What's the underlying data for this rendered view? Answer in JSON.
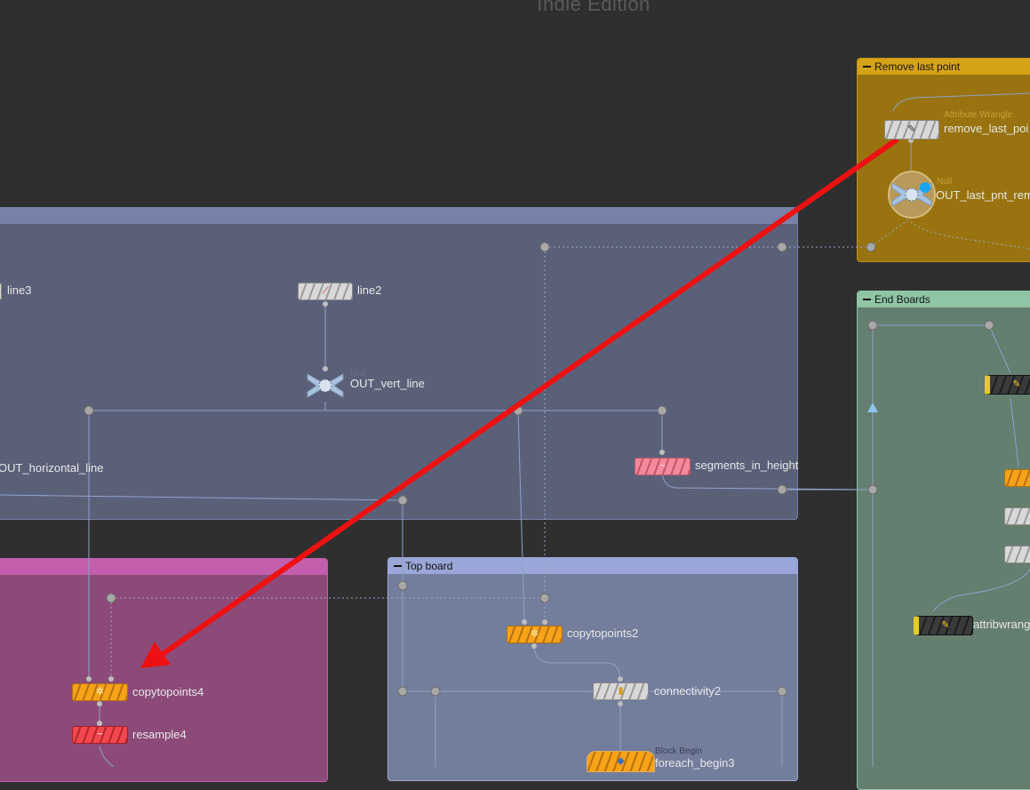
{
  "watermark": "Indie Edition",
  "boxes": {
    "remove_last_point": "Remove last point",
    "end_boards": "End Boards",
    "top_board": "Top board"
  },
  "nodes": {
    "line3": "line3",
    "line2": "line2",
    "out_vert_line": "OUT_vert_line",
    "out_vert_line_type": "Null",
    "out_horizontal_line": "OUT_horizontal_line",
    "segments_in_height": "segments_in_height",
    "copytopoints4": "copytopoints4",
    "resample4": "resample4",
    "copytopoints2": "copytopoints2",
    "connectivity2": "connectivity2",
    "foreach_begin3": "foreach_begin3",
    "foreach_begin3_type": "Block Begin",
    "remove_last_point": "remove_last_poi",
    "remove_last_point_type": "Attribute Wrangle",
    "out_last_pnt_rem": "OUT_last_pnt_rem",
    "out_last_pnt_rem_type": "Null",
    "attribwrang": "attribwrang"
  },
  "icons": {
    "annotation_arrow": "red-arrow",
    "null_node": "null-cross-icon"
  },
  "colors": {
    "background": "#2f2f2f",
    "blue_box": "#5a5f7a",
    "magenta_box": "#8e4a7a",
    "top_board_box": "#75809f",
    "remove_box": "#9a7416",
    "end_boards_box": "#667f72",
    "annotation_arrow": "#ee1111"
  }
}
